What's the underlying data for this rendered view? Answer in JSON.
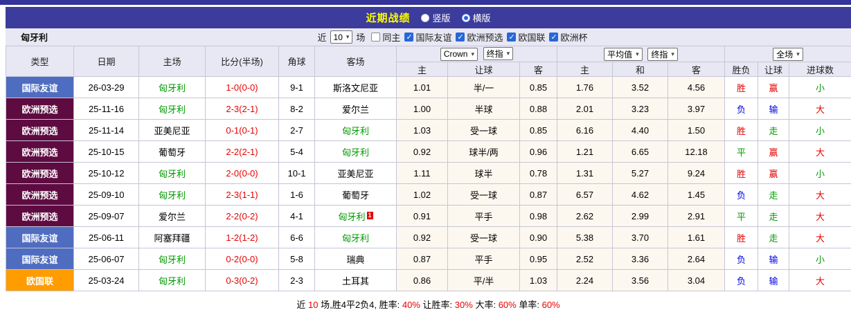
{
  "colors": {
    "title_bar_bg": "#3c3c9c",
    "title_text": "#ffff00",
    "type_friendly_bg": "#4f6dc0",
    "type_qualifier_bg": "#5e0b41",
    "type_nations_bg": "#ff9c00",
    "score_red": "#e60000",
    "win_red": "#e60000",
    "lose_blue": "#0000e6",
    "draw_green": "#009900",
    "team_green": "#009900",
    "header_bg": "#e8e8f4"
  },
  "title_bar": {
    "title": "近期战绩",
    "radios": [
      {
        "label": "竖版",
        "checked": false
      },
      {
        "label": "横版",
        "checked": true
      }
    ]
  },
  "filter_bar": {
    "team": "匈牙利",
    "near": "近",
    "count": "10",
    "unit": "场",
    "checkboxes": [
      {
        "label": "同主",
        "checked": false
      },
      {
        "label": "国际友谊",
        "checked": true
      },
      {
        "label": "欧洲预选",
        "checked": true
      },
      {
        "label": "欧国联",
        "checked": true
      },
      {
        "label": "欧洲杯",
        "checked": true
      }
    ]
  },
  "table": {
    "col_headers": {
      "type": "类型",
      "date": "日期",
      "home": "主场",
      "score": "比分(半场)",
      "corners": "角球",
      "away": "客场",
      "odds_home": "主",
      "odds_handicap": "让球",
      "odds_away": "客",
      "avg_home": "主",
      "avg_draw": "和",
      "avg_away": "客",
      "result": "胜负",
      "handicap_result": "让球",
      "goals": "进球数"
    },
    "selects": {
      "odds_company": "Crown",
      "odds_stage": "终指",
      "avg_source": "平均值",
      "avg_stage": "终指",
      "scope": "全场"
    },
    "rows": [
      {
        "type": "国际友谊",
        "type_key": "friendly",
        "date": "26-03-29",
        "home": "匈牙利",
        "home_color": "green",
        "score": "1-0(0-0)",
        "corners": "9-1",
        "away": "斯洛文尼亚",
        "away_color": "black",
        "away_card": "",
        "odds_home": "1.01",
        "odds_handicap": "半/一",
        "odds_away": "0.85",
        "avg_home": "1.76",
        "avg_draw": "3.52",
        "avg_away": "4.56",
        "result": "胜",
        "result_color": "red",
        "handicap_result": "赢",
        "handicap_color": "red",
        "goals": "小",
        "goals_color": "green"
      },
      {
        "type": "欧洲预选",
        "type_key": "qualifier",
        "date": "25-11-16",
        "home": "匈牙利",
        "home_color": "green",
        "score": "2-3(2-1)",
        "corners": "8-2",
        "away": "爱尔兰",
        "away_color": "black",
        "away_card": "",
        "odds_home": "1.00",
        "odds_handicap": "半球",
        "odds_away": "0.88",
        "avg_home": "2.01",
        "avg_draw": "3.23",
        "avg_away": "3.97",
        "result": "负",
        "result_color": "blue",
        "handicap_result": "输",
        "handicap_color": "blue",
        "goals": "大",
        "goals_color": "red"
      },
      {
        "type": "欧洲预选",
        "type_key": "qualifier",
        "date": "25-11-14",
        "home": "亚美尼亚",
        "home_color": "black",
        "score": "0-1(0-1)",
        "corners": "2-7",
        "away": "匈牙利",
        "away_color": "green",
        "away_card": "",
        "odds_home": "1.03",
        "odds_handicap": "受一球",
        "odds_away": "0.85",
        "avg_home": "6.16",
        "avg_draw": "4.40",
        "avg_away": "1.50",
        "result": "胜",
        "result_color": "red",
        "handicap_result": "走",
        "handicap_color": "green",
        "goals": "小",
        "goals_color": "green"
      },
      {
        "type": "欧洲预选",
        "type_key": "qualifier",
        "date": "25-10-15",
        "home": "葡萄牙",
        "home_color": "black",
        "score": "2-2(2-1)",
        "corners": "5-4",
        "away": "匈牙利",
        "away_color": "green",
        "away_card": "",
        "odds_home": "0.92",
        "odds_handicap": "球半/两",
        "odds_away": "0.96",
        "avg_home": "1.21",
        "avg_draw": "6.65",
        "avg_away": "12.18",
        "result": "平",
        "result_color": "green",
        "handicap_result": "赢",
        "handicap_color": "red",
        "goals": "大",
        "goals_color": "red"
      },
      {
        "type": "欧洲预选",
        "type_key": "qualifier",
        "date": "25-10-12",
        "home": "匈牙利",
        "home_color": "green",
        "score": "2-0(0-0)",
        "corners": "10-1",
        "away": "亚美尼亚",
        "away_color": "black",
        "away_card": "",
        "odds_home": "1.11",
        "odds_handicap": "球半",
        "odds_away": "0.78",
        "avg_home": "1.31",
        "avg_draw": "5.27",
        "avg_away": "9.24",
        "result": "胜",
        "result_color": "red",
        "handicap_result": "赢",
        "handicap_color": "red",
        "goals": "小",
        "goals_color": "green"
      },
      {
        "type": "欧洲预选",
        "type_key": "qualifier",
        "date": "25-09-10",
        "home": "匈牙利",
        "home_color": "green",
        "score": "2-3(1-1)",
        "corners": "1-6",
        "away": "葡萄牙",
        "away_color": "black",
        "away_card": "",
        "odds_home": "1.02",
        "odds_handicap": "受一球",
        "odds_away": "0.87",
        "avg_home": "6.57",
        "avg_draw": "4.62",
        "avg_away": "1.45",
        "result": "负",
        "result_color": "blue",
        "handicap_result": "走",
        "handicap_color": "green",
        "goals": "大",
        "goals_color": "red"
      },
      {
        "type": "欧洲预选",
        "type_key": "qualifier",
        "date": "25-09-07",
        "home": "爱尔兰",
        "home_color": "black",
        "score": "2-2(0-2)",
        "corners": "4-1",
        "away": "匈牙利",
        "away_color": "green",
        "away_card": "1",
        "odds_home": "0.91",
        "odds_handicap": "平手",
        "odds_away": "0.98",
        "avg_home": "2.62",
        "avg_draw": "2.99",
        "avg_away": "2.91",
        "result": "平",
        "result_color": "green",
        "handicap_result": "走",
        "handicap_color": "green",
        "goals": "大",
        "goals_color": "red"
      },
      {
        "type": "国际友谊",
        "type_key": "friendly",
        "date": "25-06-11",
        "home": "阿塞拜疆",
        "home_color": "black",
        "score": "1-2(1-2)",
        "corners": "6-6",
        "away": "匈牙利",
        "away_color": "green",
        "away_card": "",
        "odds_home": "0.92",
        "odds_handicap": "受一球",
        "odds_away": "0.90",
        "avg_home": "5.38",
        "avg_draw": "3.70",
        "avg_away": "1.61",
        "result": "胜",
        "result_color": "red",
        "handicap_result": "走",
        "handicap_color": "green",
        "goals": "大",
        "goals_color": "red"
      },
      {
        "type": "国际友谊",
        "type_key": "friendly",
        "date": "25-06-07",
        "home": "匈牙利",
        "home_color": "green",
        "score": "0-2(0-0)",
        "corners": "5-8",
        "away": "瑞典",
        "away_color": "black",
        "away_card": "",
        "odds_home": "0.87",
        "odds_handicap": "平手",
        "odds_away": "0.95",
        "avg_home": "2.52",
        "avg_draw": "3.36",
        "avg_away": "2.64",
        "result": "负",
        "result_color": "blue",
        "handicap_result": "输",
        "handicap_color": "blue",
        "goals": "小",
        "goals_color": "green"
      },
      {
        "type": "欧国联",
        "type_key": "nations",
        "date": "25-03-24",
        "home": "匈牙利",
        "home_color": "green",
        "score": "0-3(0-2)",
        "corners": "2-3",
        "away": "土耳其",
        "away_color": "black",
        "away_card": "",
        "odds_home": "0.86",
        "odds_handicap": "平/半",
        "odds_away": "1.03",
        "avg_home": "2.24",
        "avg_draw": "3.56",
        "avg_away": "3.04",
        "result": "负",
        "result_color": "blue",
        "handicap_result": "输",
        "handicap_color": "blue",
        "goals": "大",
        "goals_color": "red"
      }
    ]
  },
  "summary": {
    "segments": [
      {
        "text": "近",
        "color": "black"
      },
      {
        "text": "10",
        "color": "red"
      },
      {
        "text": "场,胜4平2负4, 胜率:",
        "color": "black"
      },
      {
        "text": "40%",
        "color": "red"
      },
      {
        "text": " 让胜率:",
        "color": "black"
      },
      {
        "text": "30%",
        "color": "red"
      },
      {
        "text": " 大率:",
        "color": "black"
      },
      {
        "text": "60%",
        "color": "red"
      },
      {
        "text": " 单率:",
        "color": "black"
      },
      {
        "text": "60%",
        "color": "red"
      }
    ]
  }
}
